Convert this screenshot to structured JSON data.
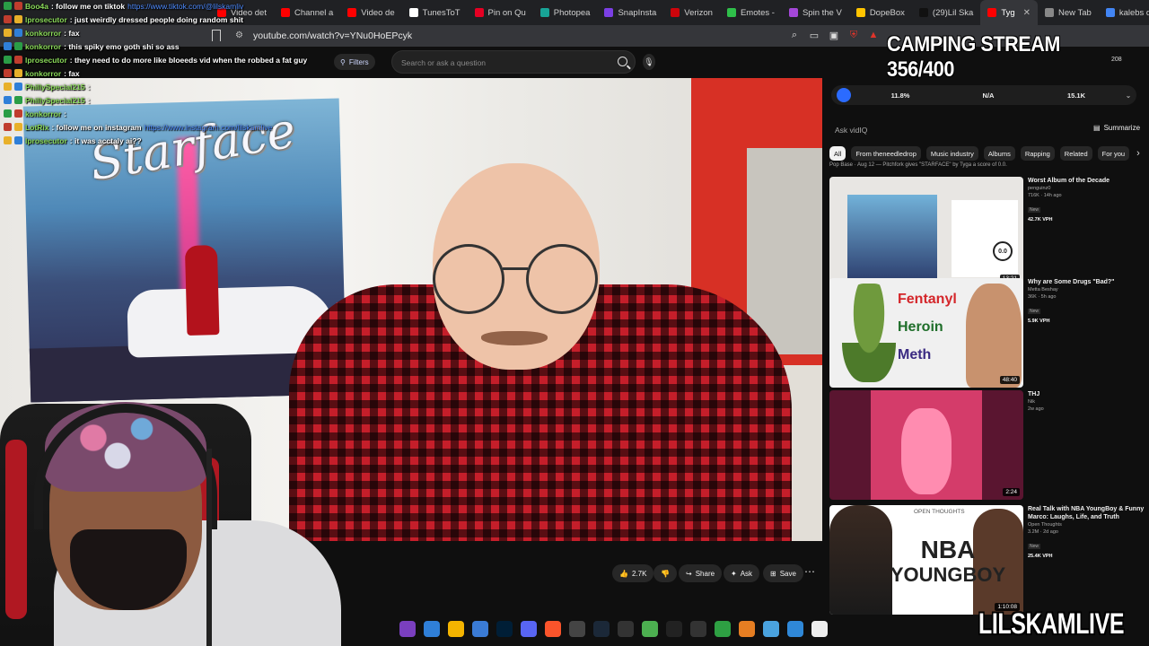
{
  "colors": {
    "chat_user": "#8bdb5a",
    "link": "#4f8cff",
    "yt_bg": "#0f0f0f",
    "shelf_red": "#d73025",
    "shirt_red": "#c51e2a"
  },
  "tabs": [
    {
      "label": "Video det",
      "color": "#ff0000"
    },
    {
      "label": "Channel a",
      "color": "#ff0000"
    },
    {
      "label": "Video de",
      "color": "#ff0000"
    },
    {
      "label": "TunesToT",
      "color": "#ffffff"
    },
    {
      "label": "Pin on Qu",
      "color": "#e60023"
    },
    {
      "label": "Photopea",
      "color": "#18a497"
    },
    {
      "label": "SnapInsta",
      "color": "#7b3fe4"
    },
    {
      "label": "Verizon",
      "color": "#cd040b"
    },
    {
      "label": "Emotes -",
      "color": "#2fbf4a"
    },
    {
      "label": "Spin the V",
      "color": "#a447d8"
    },
    {
      "label": "DopeBox",
      "color": "#ffc400"
    },
    {
      "label": "(29)Lil Ska",
      "color": "#111111"
    },
    {
      "label": "Tyg",
      "color": "#ff0000",
      "active": true
    },
    {
      "label": "New Tab",
      "color": "#888888"
    },
    {
      "label": "kalebs dr",
      "color": "#4285f4"
    }
  ],
  "address_bar": {
    "url": "youtube.com/watch?v=YNu0HoEPcyk"
  },
  "youtube": {
    "filters_label": "Filters",
    "search_placeholder": "Search or ask a question"
  },
  "chat": [
    {
      "user": "Boo4a",
      "msg": ": follow me on tiktok",
      "link": "https://www.tiktok.com/@lilskamliv"
    },
    {
      "user": "lprosecutor",
      "msg": ": just weirdly dressed people doing random shit"
    },
    {
      "user": "konkorror",
      "msg": ": fax"
    },
    {
      "user": "konkorror",
      "msg": ": this spiky emo goth shi so ass"
    },
    {
      "user": "lprosecutor",
      "msg": ": they need to do more like bloeeds vid when the robbed a fat guy"
    },
    {
      "user": "konkorror",
      "msg": ": fax"
    },
    {
      "user": "PhillySpecial215",
      "msg": ":"
    },
    {
      "user": "PhillySpecial215",
      "msg": ":"
    },
    {
      "user": "konkorror",
      "msg": ":"
    },
    {
      "user": "LotRix",
      "msg": ": follow me on instagram",
      "link": "https://www.instagram.com/lilskamlive"
    },
    {
      "user": "lprosecutor",
      "msg": ": it was acctaly ai??"
    }
  ],
  "video": {
    "poster_title": "Starface",
    "actions": {
      "like": "2.7K",
      "share": "Share",
      "ask": "Ask",
      "save": "Save"
    }
  },
  "sidebar": {
    "stats": [
      "11.8%",
      "N/A",
      "15.1K"
    ],
    "ask_placeholder": "Ask vidIQ",
    "summarize": "Summarize",
    "chips": [
      "All",
      "From theneedledrop",
      "Music industry",
      "Albums",
      "Rapping",
      "Related",
      "For you"
    ],
    "recs": [
      {
        "caption": "Pop Base · Aug 12 — Pitchfork gives \"STARFACE\" by Tyga a score of 0.0.",
        "score": "0.0",
        "title": "Worst Album of the Decade",
        "channel": "penguinz0",
        "views": "716K · 14h ago",
        "badge": "New",
        "vph": "42.7K VPH",
        "duration": "13:21"
      },
      {
        "words": [
          "Fentanyl",
          "Heroin",
          "Meth"
        ],
        "title": "Why are Some Drugs \"Bad?\"",
        "channel": "Metta Beshay",
        "views": "36K · 5h ago",
        "badge": "New",
        "vph": "5.9K VPH",
        "duration": "48:40"
      },
      {
        "title": "THJ",
        "channel": "Nik",
        "views": "2w ago",
        "badge": "",
        "vph": "",
        "duration": "2:24"
      },
      {
        "topic": "OPEN THOUGHTS",
        "nba": "NBA",
        "nba2": "YOUNGBOY",
        "title": "Real Talk with NBA YoungBoy & Funny Marco: Laughs, Life, and Truth",
        "channel": "Open Thoughts",
        "views": "3.2M · 2d ago",
        "badge": "New",
        "vph": "25.4K VPH",
        "duration": "1:10:08"
      }
    ]
  },
  "overlay": {
    "camping": "CAMPING STREAM 356/400",
    "brand": "LILSKAMLIVE",
    "mini_count": "208"
  }
}
